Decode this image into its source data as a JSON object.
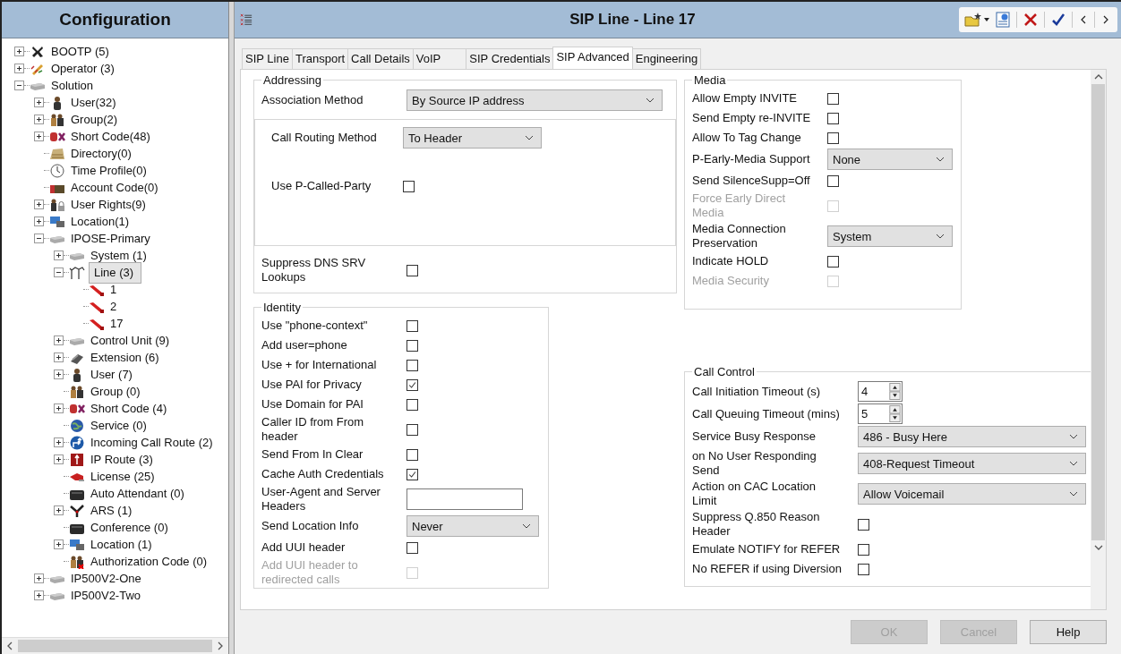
{
  "navigator": {
    "title": "Configuration",
    "tree": [
      {
        "label": "BOOTP (5)",
        "kind": "tool",
        "expanded": false,
        "selected": false
      },
      {
        "label": "Operator (3)",
        "kind": "pencil",
        "expanded": false,
        "selected": false
      },
      {
        "label": "Solution",
        "kind": "device",
        "expanded": true,
        "selected": false,
        "children": [
          {
            "label": "User(32)",
            "kind": "user",
            "expanded": false,
            "selected": false
          },
          {
            "label": "Group(2)",
            "kind": "group",
            "expanded": false,
            "selected": false
          },
          {
            "label": "Short Code(48)",
            "kind": "shortcode",
            "expanded": false,
            "selected": false
          },
          {
            "label": "Directory(0)",
            "kind": "directory",
            "selected": false
          },
          {
            "label": "Time Profile(0)",
            "kind": "clock",
            "selected": false
          },
          {
            "label": "Account Code(0)",
            "kind": "account",
            "selected": false
          },
          {
            "label": "User Rights(9)",
            "kind": "rights",
            "expanded": false,
            "selected": false
          },
          {
            "label": "Location(1)",
            "kind": "location",
            "expanded": false,
            "selected": false
          },
          {
            "label": "IPOSE-Primary",
            "kind": "device",
            "expanded": true,
            "selected": false,
            "children": [
              {
                "label": "System (1)",
                "kind": "device",
                "expanded": false,
                "selected": false
              },
              {
                "label": "Line (3)",
                "kind": "lines",
                "expanded": true,
                "selected": true,
                "children": [
                  {
                    "label": "1",
                    "kind": "line",
                    "selected": false
                  },
                  {
                    "label": "2",
                    "kind": "line",
                    "selected": false
                  },
                  {
                    "label": "17",
                    "kind": "line",
                    "selected": false
                  }
                ]
              },
              {
                "label": "Control Unit (9)",
                "kind": "device",
                "expanded": false,
                "selected": false
              },
              {
                "label": "Extension (6)",
                "kind": "phone",
                "expanded": false,
                "selected": false
              },
              {
                "label": "User (7)",
                "kind": "user",
                "expanded": false,
                "selected": false
              },
              {
                "label": "Group (0)",
                "kind": "group",
                "selected": false
              },
              {
                "label": "Short Code (4)",
                "kind": "shortcode",
                "expanded": false,
                "selected": false
              },
              {
                "label": "Service (0)",
                "kind": "globe",
                "selected": false
              },
              {
                "label": "Incoming Call Route (2)",
                "kind": "route",
                "expanded": false,
                "selected": false
              },
              {
                "label": "IP Route (3)",
                "kind": "iproute",
                "expanded": false,
                "selected": false
              },
              {
                "label": "License (25)",
                "kind": "license",
                "selected": false
              },
              {
                "label": "Auto Attendant (0)",
                "kind": "box",
                "selected": false
              },
              {
                "label": "ARS (1)",
                "kind": "ars",
                "expanded": false,
                "selected": false
              },
              {
                "label": "Conference (0)",
                "kind": "box",
                "selected": false
              },
              {
                "label": "Location (1)",
                "kind": "location",
                "expanded": false,
                "selected": false
              },
              {
                "label": "Authorization Code (0)",
                "kind": "authcode",
                "selected": false
              }
            ]
          },
          {
            "label": "IP500V2-One",
            "kind": "device",
            "expanded": false,
            "selected": false
          },
          {
            "label": "IP500V2-Two",
            "kind": "device",
            "expanded": false,
            "selected": false
          }
        ]
      }
    ]
  },
  "editor": {
    "title": "SIP Line - Line 17",
    "tabs": [
      {
        "label": "SIP Line",
        "selected": false
      },
      {
        "label": "Transport",
        "selected": false
      },
      {
        "label": "Call Details",
        "selected": false
      },
      {
        "label": "VoIP",
        "selected": false
      },
      {
        "label": "SIP Credentials",
        "selected": false
      },
      {
        "label": "SIP Advanced",
        "selected": true
      },
      {
        "label": "Engineering",
        "selected": false
      }
    ],
    "addressing": {
      "legend": "Addressing",
      "rows": [
        {
          "kind": "select",
          "label": "Association Method",
          "value": "By Source IP address"
        },
        {
          "kind": "group",
          "rows": [
            {
              "kind": "select",
              "label": "Call Routing Method",
              "value": "To Header"
            },
            {
              "kind": "checkbox",
              "label": "Use P-Called-Party",
              "checked": false,
              "disabled": false
            }
          ]
        },
        {
          "kind": "checkbox",
          "label": "Suppress DNS SRV Lookups",
          "checked": false,
          "disabled": false
        }
      ]
    },
    "identity": {
      "legend": "Identity",
      "rows": [
        {
          "kind": "checkbox",
          "label": "Use \"phone-context\"",
          "checked": false,
          "disabled": false
        },
        {
          "kind": "checkbox",
          "label": "Add user=phone",
          "checked": false,
          "disabled": false
        },
        {
          "kind": "checkbox",
          "label": "Use + for International",
          "checked": false,
          "disabled": false
        },
        {
          "kind": "checkbox",
          "label": "Use PAI for Privacy",
          "checked": true,
          "disabled": false
        },
        {
          "kind": "checkbox",
          "label": "Use Domain for PAI",
          "checked": false,
          "disabled": false
        },
        {
          "kind": "checkbox",
          "label": "Caller ID from From header",
          "checked": false,
          "disabled": false
        },
        {
          "kind": "checkbox",
          "label": "Send From In Clear",
          "checked": false,
          "disabled": false
        },
        {
          "kind": "checkbox",
          "label": "Cache Auth Credentials",
          "checked": true,
          "disabled": false
        },
        {
          "kind": "text",
          "label": "User-Agent and Server Headers"
        },
        {
          "kind": "select",
          "label": "Send Location Info",
          "value": "Never"
        },
        {
          "kind": "checkbox",
          "label": "Add UUI header",
          "checked": false,
          "disabled": false
        },
        {
          "kind": "checkbox",
          "label": "Add UUI header to redirected calls",
          "checked": false,
          "disabled": true
        }
      ]
    },
    "media": {
      "legend": "Media",
      "rows": [
        {
          "kind": "checkbox",
          "label": "Allow Empty INVITE",
          "checked": false,
          "disabled": false
        },
        {
          "kind": "checkbox",
          "label": "Send Empty re-INVITE",
          "checked": false,
          "disabled": false
        },
        {
          "kind": "checkbox",
          "label": "Allow To Tag Change",
          "checked": false,
          "disabled": false
        },
        {
          "kind": "select",
          "label": "P-Early-Media Support",
          "value": "None"
        },
        {
          "kind": "checkbox",
          "label": "Send SilenceSupp=Off",
          "checked": false,
          "disabled": false
        },
        {
          "kind": "checkbox",
          "label": "Force Early Direct Media",
          "checked": false,
          "disabled": true
        },
        {
          "kind": "select",
          "label": "Media Connection Preservation",
          "value": "System"
        },
        {
          "kind": "checkbox",
          "label": "Indicate HOLD",
          "checked": false,
          "disabled": false
        },
        {
          "kind": "checkbox",
          "label": "Media Security",
          "checked": false,
          "disabled": true
        }
      ]
    },
    "call_control": {
      "legend": "Call Control",
      "rows": [
        {
          "kind": "spin",
          "label": "Call Initiation Timeout (s)",
          "value": "4"
        },
        {
          "kind": "spin",
          "label": "Call Queuing Timeout (mins)",
          "value": "5"
        },
        {
          "kind": "select",
          "label": "Service Busy Response",
          "value": "486 - Busy Here"
        },
        {
          "kind": "select",
          "label": "on No User Responding Send",
          "value": "408-Request Timeout"
        },
        {
          "kind": "select",
          "label": "Action on CAC Location Limit",
          "value": "Allow Voicemail"
        },
        {
          "kind": "checkbox",
          "label": "Suppress Q.850 Reason Header",
          "checked": false,
          "disabled": false
        },
        {
          "kind": "checkbox",
          "label": "Emulate NOTIFY for REFER",
          "checked": false,
          "disabled": false
        },
        {
          "kind": "checkbox",
          "label": "No REFER if using Diversion",
          "checked": false,
          "disabled": false
        }
      ]
    },
    "buttons": [
      {
        "label": "OK",
        "disabled": true
      },
      {
        "label": "Cancel",
        "disabled": true
      },
      {
        "label": "Help",
        "disabled": false
      }
    ]
  }
}
